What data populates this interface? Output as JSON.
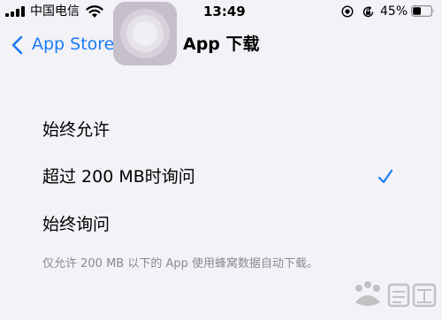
{
  "status_bar": {
    "carrier": "中国电信",
    "time": "13:49",
    "battery_percent": "45%",
    "battery_level": 0.45,
    "icons": [
      "signal-icon",
      "wifi-icon",
      "screen-record-icon",
      "orientation-lock-icon",
      "battery-icon"
    ]
  },
  "nav": {
    "back_label": "App Store",
    "title": "App 下载",
    "back_icon": "chevron-left-icon",
    "app_icon": "app-store-icon"
  },
  "options": [
    {
      "label": "始终允许",
      "selected": false
    },
    {
      "label": "超过 200 MB时询问",
      "selected": true
    },
    {
      "label": "始终询问",
      "selected": false
    }
  ],
  "footer_note": "仅允许 200 MB 以下的 App 使用蜂窝数据自动下载。",
  "watermark": {
    "logo": "baidu-jingyan-logo"
  },
  "colors": {
    "background": "#f2f2f7",
    "accent": "#1a7cf6",
    "secondary_text": "#8a8a8e"
  }
}
